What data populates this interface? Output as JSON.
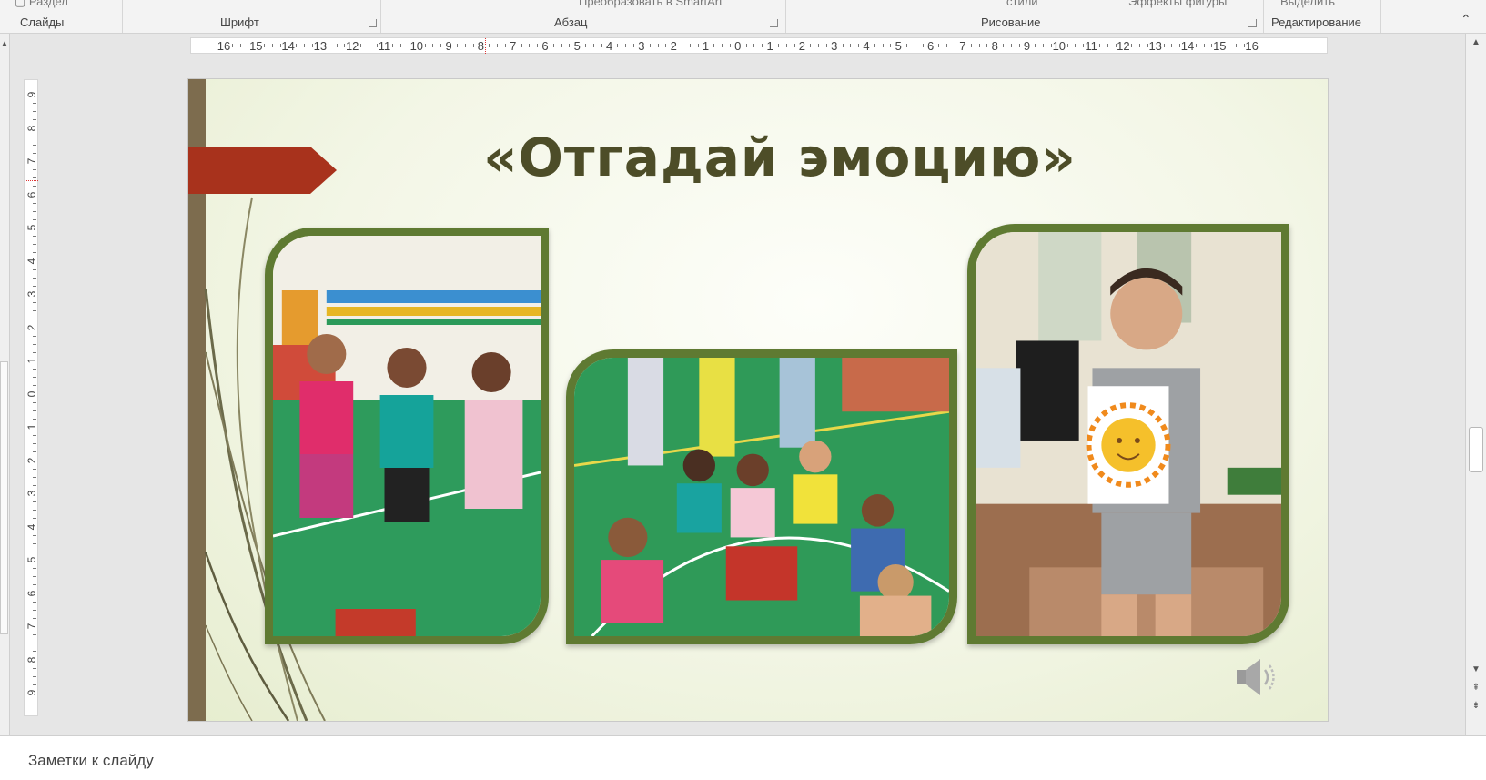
{
  "ribbon": {
    "cut_text": {
      "section": "Раздел",
      "convert_smartart": "Преобразовать в SmartArt",
      "styles": "стили",
      "shape_effects": "Эффекты фигуры",
      "select": "Выделить"
    },
    "groups": {
      "slides": "Слайды",
      "font": "Шрифт",
      "paragraph": "Абзац",
      "drawing": "Рисование",
      "editing": "Редактирование"
    }
  },
  "rulers": {
    "horizontal": [
      "16",
      "15",
      "14",
      "13",
      "12",
      "11",
      "10",
      "9",
      "8",
      "7",
      "6",
      "5",
      "4",
      "3",
      "2",
      "1",
      "0",
      "1",
      "2",
      "3",
      "4",
      "5",
      "6",
      "7",
      "8",
      "9",
      "10",
      "11",
      "12",
      "13",
      "14",
      "15",
      "16"
    ],
    "vertical": [
      "9",
      "8",
      "7",
      "6",
      "5",
      "4",
      "3",
      "2",
      "1",
      "0",
      "1",
      "2",
      "3",
      "4",
      "5",
      "6",
      "7",
      "8",
      "9"
    ]
  },
  "slide": {
    "title": "«Отгадай эмоцию»",
    "accent_colors": {
      "frame": "#5f7a32",
      "tag": "#a8321c",
      "bar": "#7d6c4e",
      "title": "#4d4d28"
    },
    "photos": [
      {
        "name": "photo-girls-with-cards"
      },
      {
        "name": "photo-children-circle"
      },
      {
        "name": "photo-boy-with-sun"
      }
    ],
    "audio_icon": "speaker-icon"
  },
  "notes": {
    "label": "Заметки к слайду"
  }
}
